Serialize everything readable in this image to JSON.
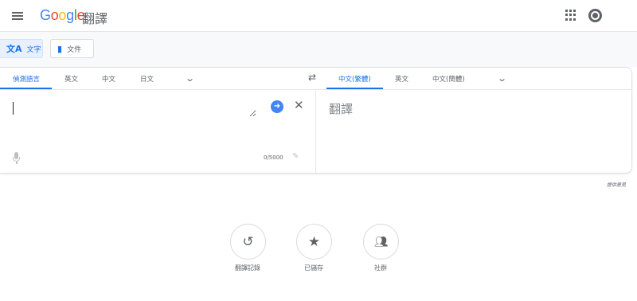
{
  "header": {
    "logo_g": "G",
    "logo_o1": "o",
    "logo_o2": "o",
    "logo_g2": "g",
    "logo_l": "l",
    "logo_e": "e",
    "logo_product": "翻譯",
    "menu_icon": "hamburger-menu-icon",
    "apps_icon": "apps-grid-icon",
    "account_icon": "account-icon"
  },
  "modes": {
    "text_label": "文字",
    "text_icon": "translate-icon",
    "doc_label": "文件",
    "doc_icon": "document-icon"
  },
  "source_langs": {
    "tabs": [
      "偵測語言",
      "英文",
      "中文",
      "日文"
    ],
    "active_index": 0,
    "more_icon": "chevron-down-icon"
  },
  "swap_icon": "swap-languages-icon",
  "target_langs": {
    "tabs": [
      "中文(繁體)",
      "英文",
      "中文(簡體)"
    ],
    "active_index": 0,
    "more_icon": "chevron-down-icon"
  },
  "source": {
    "value": "",
    "placeholder": "",
    "counter": "0/5000",
    "go_icon": "arrow-right-icon",
    "clear_icon": "close-icon",
    "mic_icon": "microphone-icon",
    "edit_icon": "pencil-icon"
  },
  "target": {
    "placeholder_text": "翻譯"
  },
  "feedback": "提供意見",
  "bottom_actions": [
    {
      "label": "翻譯記錄",
      "icon": "history-icon"
    },
    {
      "label": "已儲存",
      "icon": "star-icon"
    },
    {
      "label": "社群",
      "icon": "community-icon"
    }
  ],
  "colors": {
    "accent": "#1a73e8",
    "go_button": "#4285f4"
  }
}
